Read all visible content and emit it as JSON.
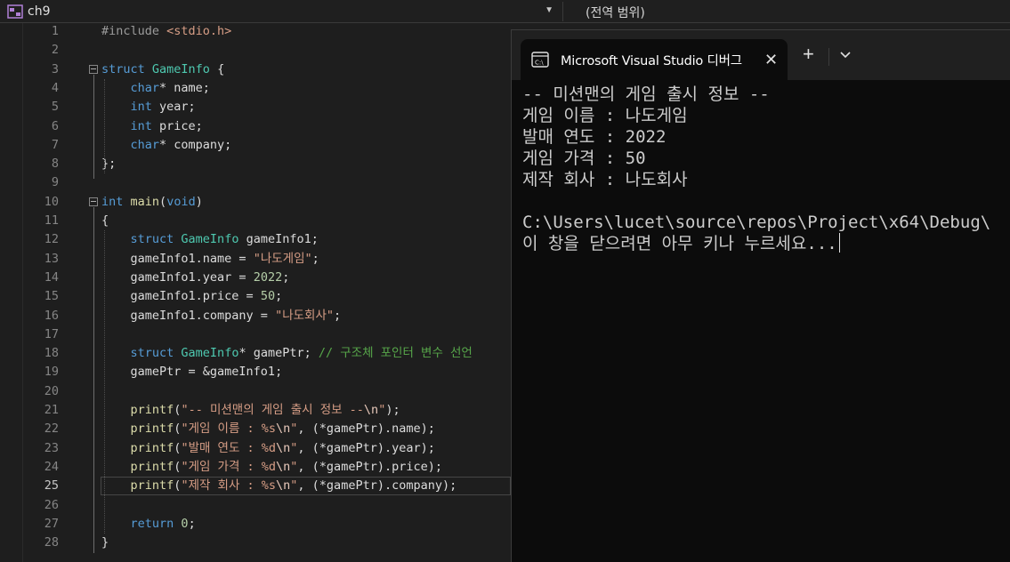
{
  "navbar": {
    "project_name": "ch9",
    "member_scope": "(전역 범위)"
  },
  "editor": {
    "current_line": 25,
    "lines": [
      {
        "n": "1",
        "tokens": [
          {
            "t": "#include ",
            "c": "pp"
          },
          {
            "t": "<stdio.h>",
            "c": "inc"
          }
        ]
      },
      {
        "n": "2",
        "tokens": []
      },
      {
        "n": "3",
        "tokens": [
          {
            "t": "struct ",
            "c": "kw"
          },
          {
            "t": "GameInfo",
            "c": "ty"
          },
          {
            "t": " {",
            "c": ""
          }
        ]
      },
      {
        "n": "4",
        "tokens": [
          {
            "t": "    ",
            "c": ""
          },
          {
            "t": "char",
            "c": "kw"
          },
          {
            "t": "* name;",
            "c": ""
          }
        ]
      },
      {
        "n": "5",
        "tokens": [
          {
            "t": "    ",
            "c": ""
          },
          {
            "t": "int",
            "c": "kw"
          },
          {
            "t": " year;",
            "c": ""
          }
        ]
      },
      {
        "n": "6",
        "tokens": [
          {
            "t": "    ",
            "c": ""
          },
          {
            "t": "int",
            "c": "kw"
          },
          {
            "t": " price;",
            "c": ""
          }
        ]
      },
      {
        "n": "7",
        "tokens": [
          {
            "t": "    ",
            "c": ""
          },
          {
            "t": "char",
            "c": "kw"
          },
          {
            "t": "* company;",
            "c": ""
          }
        ]
      },
      {
        "n": "8",
        "tokens": [
          {
            "t": "};",
            "c": ""
          }
        ]
      },
      {
        "n": "9",
        "tokens": []
      },
      {
        "n": "10",
        "tokens": [
          {
            "t": "int",
            "c": "kw"
          },
          {
            "t": " ",
            "c": ""
          },
          {
            "t": "main",
            "c": "fn"
          },
          {
            "t": "(",
            "c": ""
          },
          {
            "t": "void",
            "c": "kw"
          },
          {
            "t": ")",
            "c": ""
          }
        ]
      },
      {
        "n": "11",
        "tokens": [
          {
            "t": "{",
            "c": ""
          }
        ]
      },
      {
        "n": "12",
        "tokens": [
          {
            "t": "    ",
            "c": ""
          },
          {
            "t": "struct ",
            "c": "kw"
          },
          {
            "t": "GameInfo",
            "c": "ty"
          },
          {
            "t": " gameInfo1;",
            "c": ""
          }
        ]
      },
      {
        "n": "13",
        "tokens": [
          {
            "t": "    gameInfo1.name = ",
            "c": ""
          },
          {
            "t": "\"나도게임\"",
            "c": "str"
          },
          {
            "t": ";",
            "c": ""
          }
        ]
      },
      {
        "n": "14",
        "tokens": [
          {
            "t": "    gameInfo1.year = ",
            "c": ""
          },
          {
            "t": "2022",
            "c": "num"
          },
          {
            "t": ";",
            "c": ""
          }
        ]
      },
      {
        "n": "15",
        "tokens": [
          {
            "t": "    gameInfo1.price = ",
            "c": ""
          },
          {
            "t": "50",
            "c": "num"
          },
          {
            "t": ";",
            "c": ""
          }
        ]
      },
      {
        "n": "16",
        "tokens": [
          {
            "t": "    gameInfo1.company = ",
            "c": ""
          },
          {
            "t": "\"나도회사\"",
            "c": "str"
          },
          {
            "t": ";",
            "c": ""
          }
        ]
      },
      {
        "n": "17",
        "tokens": []
      },
      {
        "n": "18",
        "tokens": [
          {
            "t": "    ",
            "c": ""
          },
          {
            "t": "struct ",
            "c": "kw"
          },
          {
            "t": "GameInfo",
            "c": "ty"
          },
          {
            "t": "* gamePtr; ",
            "c": ""
          },
          {
            "t": "// 구조체 포인터 변수 선언",
            "c": "cm"
          }
        ]
      },
      {
        "n": "19",
        "tokens": [
          {
            "t": "    gamePtr = &gameInfo1;",
            "c": ""
          }
        ]
      },
      {
        "n": "20",
        "tokens": []
      },
      {
        "n": "21",
        "tokens": [
          {
            "t": "    ",
            "c": ""
          },
          {
            "t": "printf",
            "c": "fn"
          },
          {
            "t": "(",
            "c": ""
          },
          {
            "t": "\"-- 미션맨의 게임 출시 정보 --",
            "c": "str"
          },
          {
            "t": "\\n",
            "c": "esc"
          },
          {
            "t": "\"",
            "c": "str"
          },
          {
            "t": ");",
            "c": ""
          }
        ]
      },
      {
        "n": "22",
        "tokens": [
          {
            "t": "    ",
            "c": ""
          },
          {
            "t": "printf",
            "c": "fn"
          },
          {
            "t": "(",
            "c": ""
          },
          {
            "t": "\"게임 이름 : %s",
            "c": "str"
          },
          {
            "t": "\\n",
            "c": "esc"
          },
          {
            "t": "\"",
            "c": "str"
          },
          {
            "t": ", (*gamePtr).name);",
            "c": ""
          }
        ]
      },
      {
        "n": "23",
        "tokens": [
          {
            "t": "    ",
            "c": ""
          },
          {
            "t": "printf",
            "c": "fn"
          },
          {
            "t": "(",
            "c": ""
          },
          {
            "t": "\"발매 연도 : %d",
            "c": "str"
          },
          {
            "t": "\\n",
            "c": "esc"
          },
          {
            "t": "\"",
            "c": "str"
          },
          {
            "t": ", (*gamePtr).year);",
            "c": ""
          }
        ]
      },
      {
        "n": "24",
        "tokens": [
          {
            "t": "    ",
            "c": ""
          },
          {
            "t": "printf",
            "c": "fn"
          },
          {
            "t": "(",
            "c": ""
          },
          {
            "t": "\"게임 가격 : %d",
            "c": "str"
          },
          {
            "t": "\\n",
            "c": "esc"
          },
          {
            "t": "\"",
            "c": "str"
          },
          {
            "t": ", (*gamePtr).price);",
            "c": ""
          }
        ]
      },
      {
        "n": "25",
        "tokens": [
          {
            "t": "    ",
            "c": ""
          },
          {
            "t": "printf",
            "c": "fn"
          },
          {
            "t": "(",
            "c": ""
          },
          {
            "t": "\"제작 회사 : %s",
            "c": "str"
          },
          {
            "t": "\\n",
            "c": "esc"
          },
          {
            "t": "\"",
            "c": "str"
          },
          {
            "t": ", (*gamePtr).company);",
            "c": ""
          }
        ]
      },
      {
        "n": "26",
        "tokens": []
      },
      {
        "n": "27",
        "tokens": [
          {
            "t": "    ",
            "c": ""
          },
          {
            "t": "return ",
            "c": "kw"
          },
          {
            "t": "0",
            "c": "num"
          },
          {
            "t": ";",
            "c": ""
          }
        ]
      },
      {
        "n": "28",
        "tokens": [
          {
            "t": "}",
            "c": ""
          }
        ]
      }
    ]
  },
  "console": {
    "tab_title": "Microsoft Visual Studio 디버그",
    "output_lines": [
      "-- 미션맨의 게임 출시 정보 --",
      "게임 이름 : 나도게임",
      "발매 연도 : 2022",
      "게임 가격 : 50",
      "제작 회사 : 나도회사",
      "",
      "C:\\Users\\lucet\\source\\repos\\Project\\x64\\Debug\\",
      "이 창을 닫으려면 아무 키나 누르세요..."
    ]
  },
  "colors": {
    "editor_bg": "#1e1e1e",
    "console_bg": "#0c0c0c",
    "keyword": "#569cd6",
    "type": "#4ec9b0",
    "string": "#d69d85",
    "comment": "#57a64a"
  }
}
